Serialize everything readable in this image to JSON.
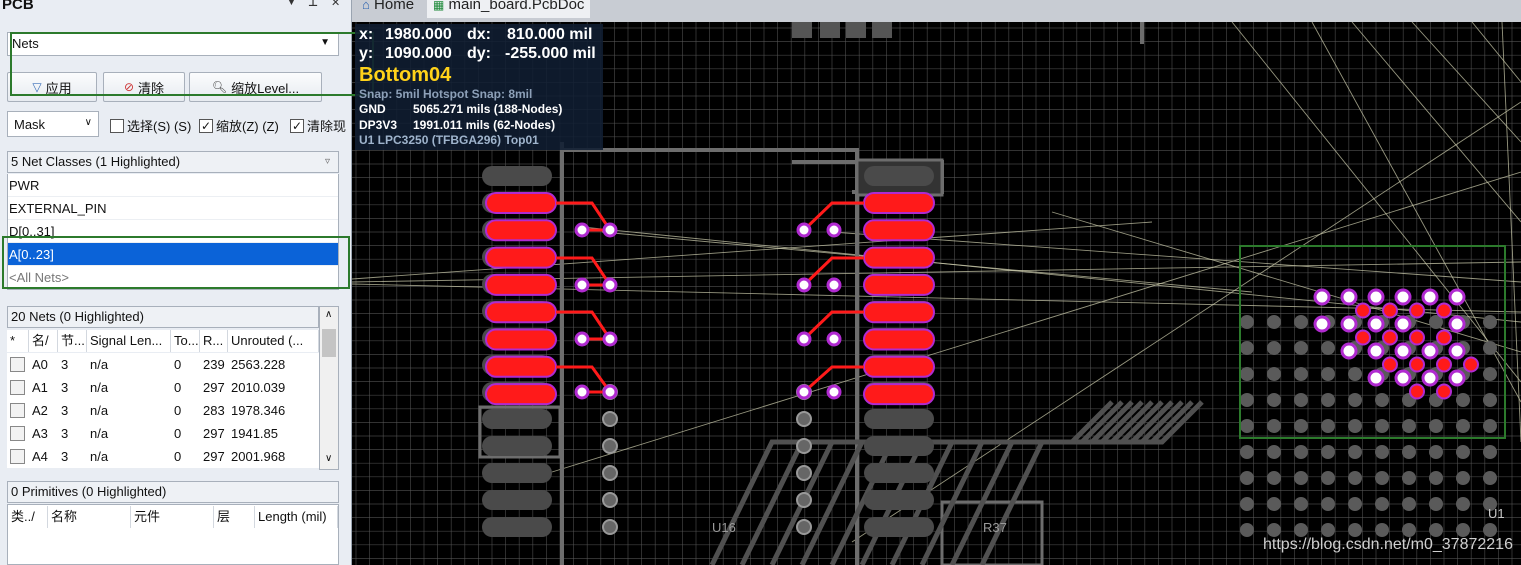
{
  "panel": {
    "title": "PCB",
    "filter_select": "Nets",
    "buttons": {
      "apply": "应用",
      "clear": "清除",
      "zoom": "缩放Level..."
    },
    "mask_select": "Mask",
    "checks": [
      {
        "label": "选择(S) (S)",
        "checked": false
      },
      {
        "label": "缩放(Z) (Z)",
        "checked": true
      },
      {
        "label": "清除现",
        "checked": true
      }
    ],
    "net_classes_header": "5 Net Classes (1 Highlighted)",
    "net_classes": [
      {
        "label": "PWR"
      },
      {
        "label": "EXTERNAL_PIN"
      },
      {
        "label": "D[0..31]"
      },
      {
        "label": "A[0..23]"
      },
      {
        "label": "<All Nets>"
      }
    ],
    "nets_header": "20 Nets (0 Highlighted)",
    "nets_columns": [
      "*",
      "名/",
      "节...",
      "Signal Len...",
      "To...",
      "R...",
      "Unrouted (..."
    ],
    "nets_rows": [
      {
        "name": "A0",
        "nodes": "3",
        "signal": "n/a",
        "to": "0",
        "r": "239",
        "unrouted": "2563.228"
      },
      {
        "name": "A1",
        "nodes": "3",
        "signal": "n/a",
        "to": "0",
        "r": "297",
        "unrouted": "2010.039"
      },
      {
        "name": "A2",
        "nodes": "3",
        "signal": "n/a",
        "to": "0",
        "r": "283",
        "unrouted": "1978.346"
      },
      {
        "name": "A3",
        "nodes": "3",
        "signal": "n/a",
        "to": "0",
        "r": "297",
        "unrouted": "1941.85"
      },
      {
        "name": "A4",
        "nodes": "3",
        "signal": "n/a",
        "to": "0",
        "r": "297",
        "unrouted": "2001.968"
      }
    ],
    "primitives_header": "0 Primitives (0 Highlighted)",
    "primitives_columns": [
      "类../",
      "名称",
      "元件",
      "层",
      "Length (mil)"
    ]
  },
  "tabs": [
    {
      "label": "Home",
      "icon": "home-icon"
    },
    {
      "label": "main_board.PcbDoc",
      "icon": "pcb-doc-icon"
    }
  ],
  "hud": {
    "x_label": "x:",
    "x_value": "1980.000",
    "dx_label": "dx:",
    "dx_value": "810.000 mil",
    "y_label": "y:",
    "y_value": "1090.000",
    "dy_label": "dy:",
    "dy_value": "-255.000 mil",
    "layer": "Bottom04",
    "snap": "Snap: 5mil Hotspot Snap: 8mil",
    "nets": [
      {
        "name": "GND",
        "info": "5065.271 mils (188-Nodes)"
      },
      {
        "name": "DP3V3",
        "info": "1991.011 mils (62-Nodes)"
      }
    ],
    "component": "U1  LPC3250 (TFBGA296)  Top01"
  },
  "canvas_labels": {
    "u16": "U16",
    "r37": "R37",
    "u1": "U1"
  },
  "colors": {
    "highlight_net": "#ff1a1a",
    "pad_ring": "#b02ad0",
    "selection": "#0b63d8",
    "annotation_box": "#2c7a2c",
    "grid": "#5a5a5a"
  },
  "watermark": "https://blog.csdn.net/m0_37872216"
}
